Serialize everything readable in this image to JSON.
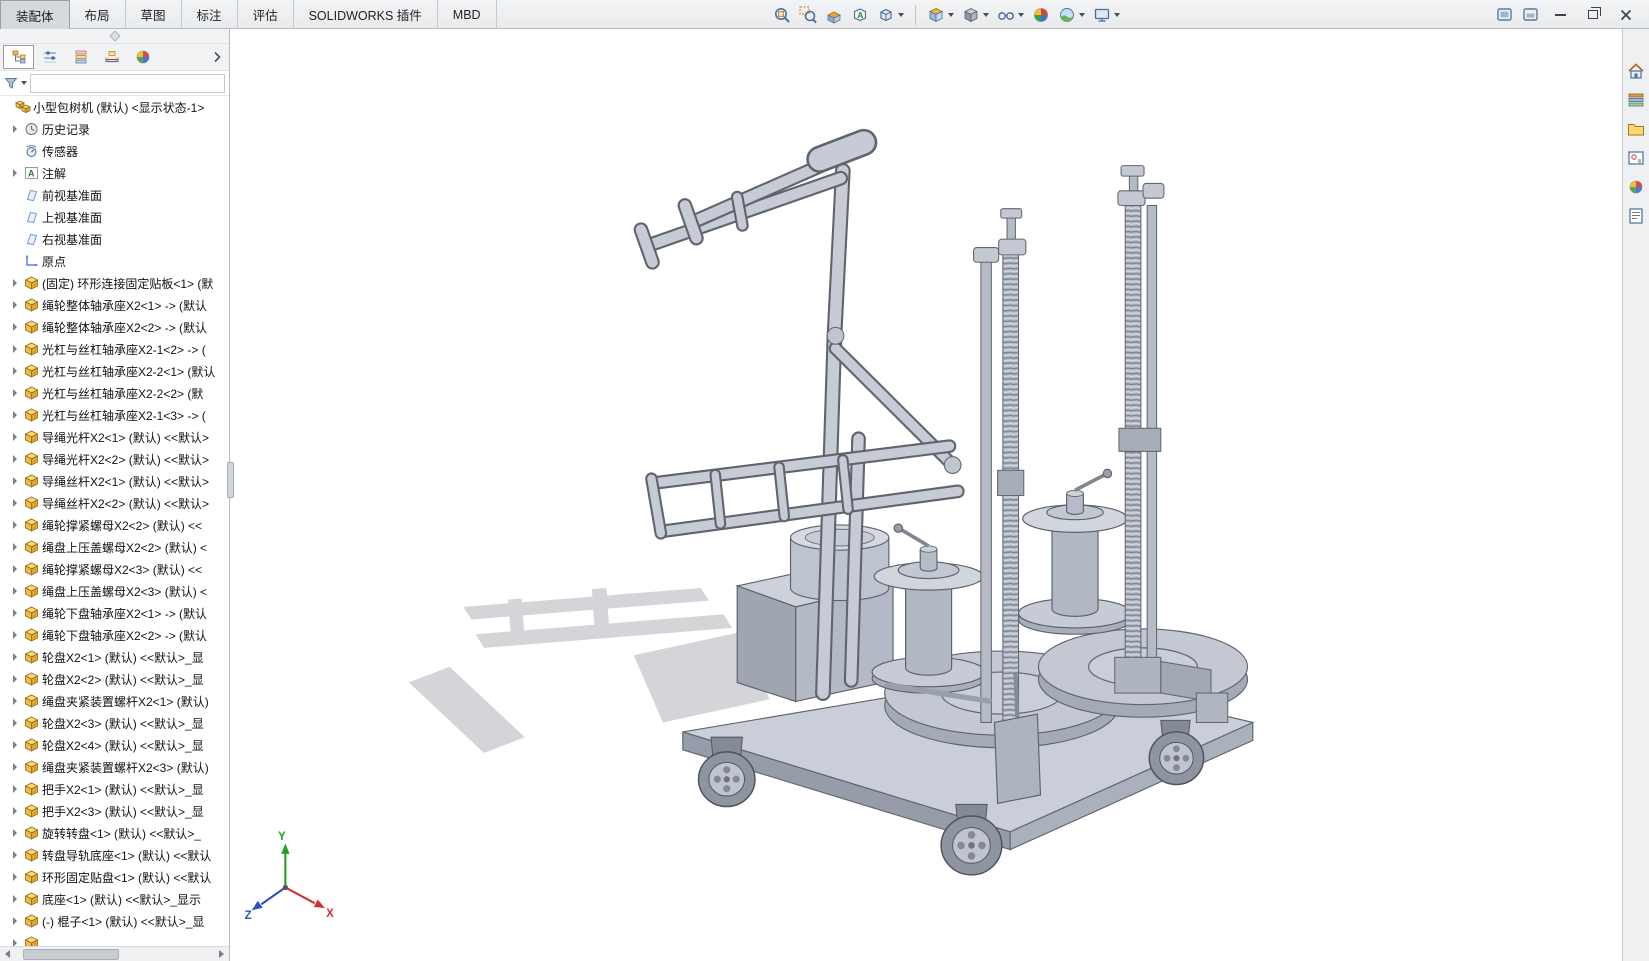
{
  "colors": {
    "accent_blue": "#4a6f9b",
    "part_icon_yellow": "#f2b63d",
    "model_gray": "#c3c8d2",
    "viewport_background": "#ffffff",
    "topbar_background": "#eceef0"
  },
  "command_manager": {
    "tabs": [
      {
        "id": "assembly",
        "label": "装配体",
        "active": true
      },
      {
        "id": "layout",
        "label": "布局",
        "active": false
      },
      {
        "id": "sketch",
        "label": "草图",
        "active": false
      },
      {
        "id": "annotation",
        "label": "标注",
        "active": false
      },
      {
        "id": "evaluate",
        "label": "评估",
        "active": false
      },
      {
        "id": "solidworks-addins",
        "label": "SOLIDWORKS 插件",
        "active": false
      },
      {
        "id": "mbd",
        "label": "MBD",
        "active": false
      }
    ]
  },
  "heads_up_toolbar": {
    "icons": [
      {
        "id": "zoom-to-fit",
        "dropdown": false
      },
      {
        "id": "zoom-to-area",
        "dropdown": false
      },
      {
        "id": "section-view",
        "dropdown": false
      },
      {
        "id": "annotation-view",
        "dropdown": false
      },
      {
        "id": "3d-drawing-view",
        "dropdown": true
      },
      {
        "separator": true
      },
      {
        "id": "view-orientation",
        "dropdown": true
      },
      {
        "id": "display-style",
        "dropdown": true
      },
      {
        "id": "hide-show-items",
        "dropdown": true
      },
      {
        "id": "edit-appearance",
        "dropdown": false
      },
      {
        "id": "apply-scene",
        "dropdown": true
      },
      {
        "id": "view-settings",
        "dropdown": true
      }
    ]
  },
  "window_controls": {
    "document_buttons": [
      {
        "id": "doc-window-1"
      },
      {
        "id": "doc-window-2"
      }
    ],
    "buttons": [
      {
        "id": "minimize"
      },
      {
        "id": "maximize"
      },
      {
        "id": "close"
      }
    ]
  },
  "feature_panel": {
    "tabs": [
      "featuremanager",
      "propertymanager",
      "configurationmanager",
      "dimxpertmanager",
      "displaymanager"
    ],
    "active_tab": "featuremanager",
    "filter": {
      "value": ""
    },
    "root": {
      "icon": "assembly",
      "label": "小型包树机 (默认) <显示状态-1>"
    },
    "items": [
      {
        "icon": "history",
        "label": "历史记录",
        "arrow": true
      },
      {
        "icon": "sensors",
        "label": "传感器",
        "arrow": false
      },
      {
        "icon": "annotations",
        "label": "注解",
        "arrow": true
      },
      {
        "icon": "plane",
        "label": "前视基准面",
        "arrow": false
      },
      {
        "icon": "plane",
        "label": "上视基准面",
        "arrow": false
      },
      {
        "icon": "plane",
        "label": "右视基准面",
        "arrow": false
      },
      {
        "icon": "origin",
        "label": "原点",
        "arrow": false
      },
      {
        "icon": "part",
        "label": "(固定) 环形连接固定贴板<1> (默",
        "arrow": true
      },
      {
        "icon": "part",
        "label": "绳轮整体轴承座X2<1> -> (默认",
        "arrow": true
      },
      {
        "icon": "part",
        "label": "绳轮整体轴承座X2<2> -> (默认",
        "arrow": true
      },
      {
        "icon": "part",
        "label": "光杠与丝杠轴承座X2-1<2> -> (",
        "arrow": true
      },
      {
        "icon": "part",
        "label": "光杠与丝杠轴承座X2-2<1> (默认",
        "arrow": true
      },
      {
        "icon": "part",
        "label": "光杠与丝杠轴承座X2-2<2> (默",
        "arrow": true
      },
      {
        "icon": "part",
        "label": "光杠与丝杠轴承座X2-1<3> -> (",
        "arrow": true
      },
      {
        "icon": "part",
        "label": "导绳光杆X2<1> (默认) <<默认>",
        "arrow": true
      },
      {
        "icon": "part",
        "label": "导绳光杆X2<2> (默认) <<默认>",
        "arrow": true
      },
      {
        "icon": "part",
        "label": "导绳丝杆X2<1> (默认) <<默认>",
        "arrow": true
      },
      {
        "icon": "part",
        "label": "导绳丝杆X2<2> (默认) <<默认>",
        "arrow": true
      },
      {
        "icon": "part",
        "label": "绳轮撑紧螺母X2<2> (默认) <<",
        "arrow": true
      },
      {
        "icon": "part",
        "label": "绳盘上压盖螺母X2<2> (默认) <",
        "arrow": true
      },
      {
        "icon": "part",
        "label": "绳轮撑紧螺母X2<3> (默认) <<",
        "arrow": true
      },
      {
        "icon": "part",
        "label": "绳盘上压盖螺母X2<3> (默认) <",
        "arrow": true
      },
      {
        "icon": "part",
        "label": "绳轮下盘轴承座X2<1> -> (默认",
        "arrow": true
      },
      {
        "icon": "part",
        "label": "绳轮下盘轴承座X2<2> -> (默认",
        "arrow": true
      },
      {
        "icon": "part",
        "label": "轮盘X2<1> (默认) <<默认>_显",
        "arrow": true
      },
      {
        "icon": "part",
        "label": "轮盘X2<2> (默认) <<默认>_显",
        "arrow": true
      },
      {
        "icon": "part",
        "label": "绳盘夹紧装置螺杆X2<1> (默认)",
        "arrow": true
      },
      {
        "icon": "part",
        "label": "轮盘X2<3> (默认) <<默认>_显",
        "arrow": true
      },
      {
        "icon": "part",
        "label": "轮盘X2<4> (默认) <<默认>_显",
        "arrow": true
      },
      {
        "icon": "part",
        "label": "绳盘夹紧装置螺杆X2<3> (默认)",
        "arrow": true
      },
      {
        "icon": "part",
        "label": "把手X2<1> (默认) <<默认>_显",
        "arrow": true
      },
      {
        "icon": "part",
        "label": "把手X2<3> (默认) <<默认>_显",
        "arrow": true
      },
      {
        "icon": "part",
        "label": "旋转转盘<1> (默认) <<默认>_",
        "arrow": true
      },
      {
        "icon": "part",
        "label": "转盘导轨底座<1> (默认) <<默认",
        "arrow": true
      },
      {
        "icon": "part",
        "label": "环形固定贴盘<1> (默认) <<默认",
        "arrow": true
      },
      {
        "icon": "part",
        "label": "底座<1> (默认) <<默认>_显示",
        "arrow": true
      },
      {
        "icon": "part",
        "label": "(-) 棍子<1> (默认) <<默认>_显",
        "arrow": true
      },
      {
        "icon": "part",
        "label": "",
        "arrow": true
      }
    ]
  },
  "task_pane": {
    "icons": [
      "solidworks-resources",
      "design-library",
      "file-explorer",
      "view-palette",
      "appearances-scenes",
      "custom-properties"
    ]
  },
  "viewport": {
    "triad": {
      "x": "X",
      "y": "Y",
      "z": "Z"
    }
  }
}
